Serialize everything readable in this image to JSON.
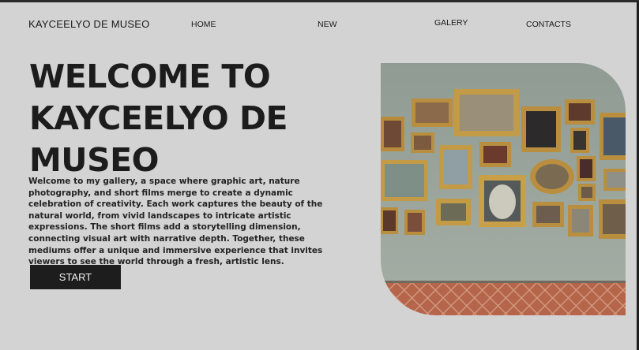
{
  "brand": "KAYCEELYO DE MUSEO",
  "nav": {
    "home": "HOME",
    "new": "NEW",
    "galery": "GALERY",
    "contacts": "CONTACTS"
  },
  "hero": {
    "title": "WELCOME TO KAYCEELYO DE MUSEO",
    "description": "Welcome to my gallery, a space where graphic art, nature photography, and short films merge to create a dynamic celebration of creativity. Each work captures the beauty of the natural world, from vivid landscapes to intricate artistic expressions. The short films add a storytelling dimension, connecting visual art with narrative depth. Together, these mediums offer a unique and immersive experience that invites viewers to see the world through a fresh, artistic lens.",
    "button": "START"
  }
}
